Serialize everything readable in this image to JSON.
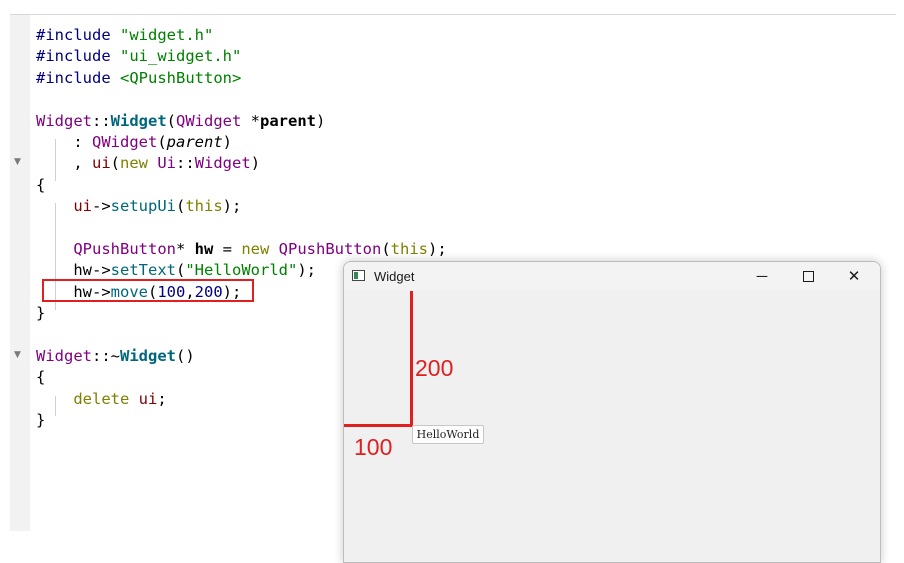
{
  "code": {
    "lines": [
      [
        {
          "t": "#include ",
          "c": "pp"
        },
        {
          "t": "\"widget.h\"",
          "c": "str"
        }
      ],
      [
        {
          "t": "#include ",
          "c": "pp"
        },
        {
          "t": "\"ui_widget.h\"",
          "c": "str"
        }
      ],
      [
        {
          "t": "#include ",
          "c": "pp"
        },
        {
          "t": "<QPushButton>",
          "c": "str"
        }
      ],
      [],
      [
        {
          "t": "Widget",
          "c": "typ"
        },
        {
          "t": "::"
        },
        {
          "t": "Widget",
          "c": "bfn"
        },
        {
          "t": "("
        },
        {
          "t": "QWidget",
          "c": "typ"
        },
        {
          "t": " *"
        },
        {
          "t": "parent",
          "c": "bold"
        },
        {
          "t": ")"
        }
      ],
      [
        {
          "t": "    : "
        },
        {
          "t": "QWidget",
          "c": "typ"
        },
        {
          "t": "("
        },
        {
          "t": "parent",
          "c": "ital"
        },
        {
          "t": ")"
        }
      ],
      [
        {
          "t": "    , "
        },
        {
          "t": "ui",
          "c": "var"
        },
        {
          "t": "("
        },
        {
          "t": "new ",
          "c": "kw"
        },
        {
          "t": "Ui",
          "c": "typ"
        },
        {
          "t": "::"
        },
        {
          "t": "Widget",
          "c": "typ"
        },
        {
          "t": ")"
        }
      ],
      [
        {
          "t": "{"
        }
      ],
      [
        {
          "t": "    "
        },
        {
          "t": "ui",
          "c": "var"
        },
        {
          "t": "->"
        },
        {
          "t": "setupUi",
          "c": "fn"
        },
        {
          "t": "("
        },
        {
          "t": "this",
          "c": "kw"
        },
        {
          "t": ");"
        }
      ],
      [],
      [
        {
          "t": "    "
        },
        {
          "t": "QPushButton",
          "c": "typ"
        },
        {
          "t": "* "
        },
        {
          "t": "hw",
          "c": "bold"
        },
        {
          "t": " = "
        },
        {
          "t": "new ",
          "c": "kw"
        },
        {
          "t": "QPushButton",
          "c": "typ"
        },
        {
          "t": "("
        },
        {
          "t": "this",
          "c": "kw"
        },
        {
          "t": ");"
        }
      ],
      [
        {
          "t": "    hw->"
        },
        {
          "t": "setText",
          "c": "fn"
        },
        {
          "t": "("
        },
        {
          "t": "\"HelloWorld\"",
          "c": "str"
        },
        {
          "t": ");"
        }
      ],
      [
        {
          "t": "    hw->"
        },
        {
          "t": "move",
          "c": "fn"
        },
        {
          "t": "("
        },
        {
          "t": "100",
          "c": "num"
        },
        {
          "t": ","
        },
        {
          "t": "200",
          "c": "num"
        },
        {
          "t": ");"
        }
      ],
      [
        {
          "t": "}"
        }
      ],
      [],
      [
        {
          "t": "Widget",
          "c": "typ"
        },
        {
          "t": "::~"
        },
        {
          "t": "Widget",
          "c": "bfn"
        },
        {
          "t": "()"
        }
      ],
      [
        {
          "t": "{"
        }
      ],
      [
        {
          "t": "    "
        },
        {
          "t": "delete ",
          "c": "kw"
        },
        {
          "t": "ui",
          "c": "var"
        },
        {
          "t": ";"
        }
      ],
      [
        {
          "t": "}"
        }
      ]
    ]
  },
  "window": {
    "title": "Widget",
    "minimize_glyph": "─",
    "close_glyph": "✕",
    "button_label": "HelloWorld"
  },
  "annotations": {
    "x_label": "100",
    "y_label": "200",
    "color": "#e02020"
  },
  "icons": {
    "fold_marker": "fold-arrow-icon",
    "app": "widget-app-icon"
  }
}
